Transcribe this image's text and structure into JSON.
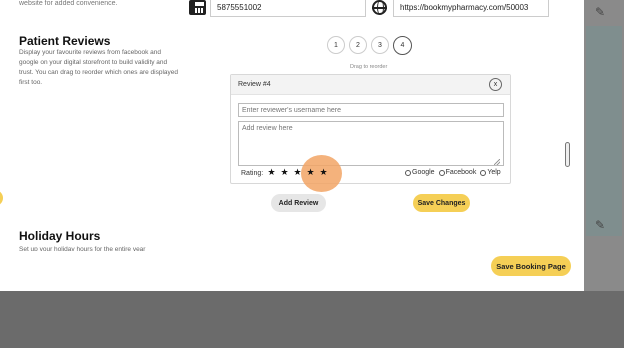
{
  "top_desc": "website for added convenience.",
  "contact": {
    "fax_icon": "fax-icon",
    "fax_value": "5875551002",
    "globe_icon": "globe-icon",
    "website_value": "https://bookmypharmacy.com/50003"
  },
  "reviews_section": {
    "title": "Patient Reviews",
    "description": "Display your favourite reviews from facebook and google on your digital storefront to build validity and trust. You can drag to reorder which ones are displayed first too.",
    "pages": [
      "1",
      "2",
      "3",
      "4"
    ],
    "active_page": "4",
    "drag_hint": "Drag to reorder",
    "card": {
      "title": "Review #4",
      "close_label": "x",
      "username_placeholder": "Enter reviewer's username here",
      "review_placeholder": "Add review here",
      "rating_label": "Rating:",
      "stars": [
        "★",
        "★",
        "★",
        "★",
        "★"
      ],
      "sources": [
        "Google",
        "Facebook",
        "Yelp"
      ]
    },
    "add_review_label": "Add Review",
    "save_changes_label": "Save Changes"
  },
  "holiday_section": {
    "title": "Holiday Hours",
    "description": "Set up your holiday hours for the entire year"
  },
  "save_booking_label": "Save Booking Page",
  "colors": {
    "accent_yellow": "#f5cf56",
    "highlight_orange": "#f2a565",
    "backdrop": "#6b6b6b"
  }
}
